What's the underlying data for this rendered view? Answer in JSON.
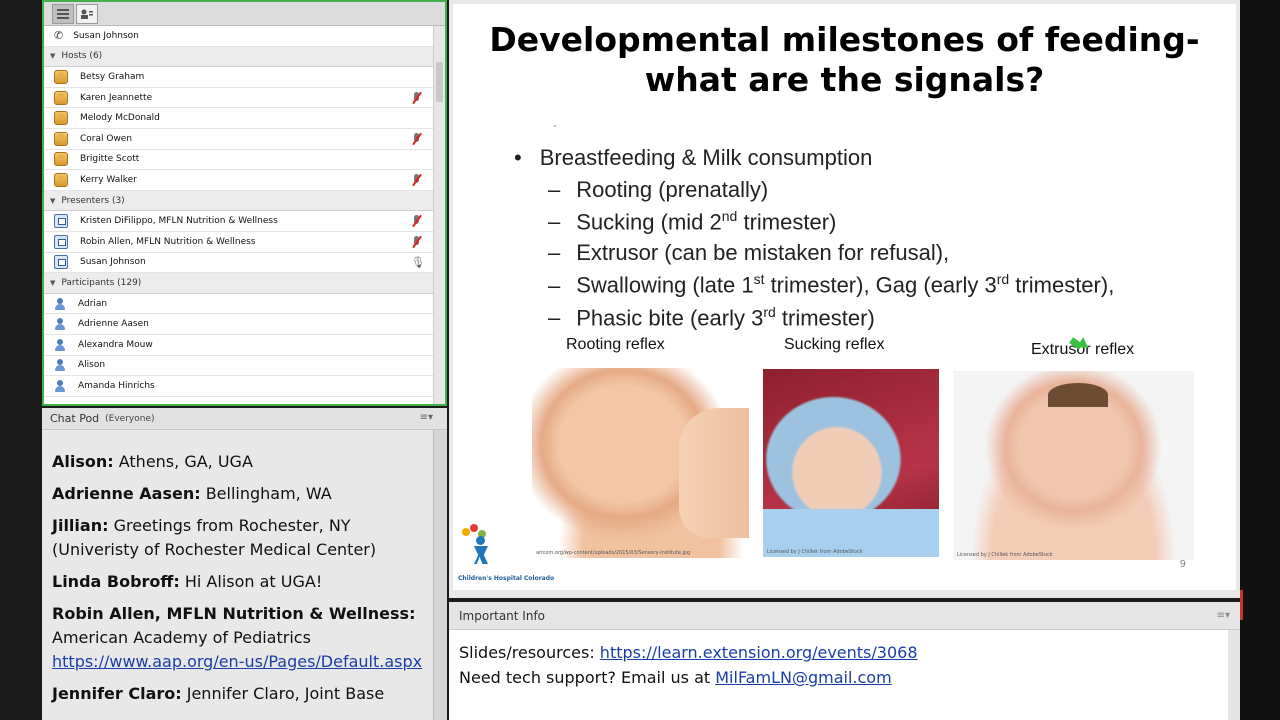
{
  "attendees": {
    "current_user": "Susan Johnson",
    "groups": [
      {
        "label": "Hosts (6)",
        "role": "host",
        "members": [
          {
            "name": "Betsy Graham",
            "status": ""
          },
          {
            "name": "Karen Jeannette",
            "status": "mic-off"
          },
          {
            "name": "Melody McDonald",
            "status": ""
          },
          {
            "name": "Coral Owen",
            "status": "mic-off"
          },
          {
            "name": "Brigitte Scott",
            "status": ""
          },
          {
            "name": "Kerry Walker",
            "status": "mic-off"
          }
        ]
      },
      {
        "label": "Presenters (3)",
        "role": "presenter",
        "members": [
          {
            "name": "Kristen DiFilippo, MFLN Nutrition & Wellness",
            "status": "mic-off"
          },
          {
            "name": "Robin Allen, MFLN Nutrition & Wellness",
            "status": "mic-off"
          },
          {
            "name": "Susan Johnson",
            "status": "speaking"
          }
        ]
      },
      {
        "label": "Participants (129)",
        "role": "participant",
        "members": [
          {
            "name": "Adrian",
            "status": ""
          },
          {
            "name": "Adrienne Aasen",
            "status": ""
          },
          {
            "name": "Alexandra Mouw",
            "status": ""
          },
          {
            "name": "Alison",
            "status": ""
          },
          {
            "name": "Amanda Hinrichs",
            "status": ""
          }
        ]
      }
    ]
  },
  "chat": {
    "title": "Chat Pod",
    "scope": "(Everyone)",
    "messages": [
      {
        "sender": "Alison:",
        "text": " Athens, GA, UGA"
      },
      {
        "sender": "Adrienne Aasen:",
        "text": " Bellingham, WA"
      },
      {
        "sender": "Jillian:",
        "text": " Greetings from Rochester, NY (Univeristy of Rochester Medical Center)"
      },
      {
        "sender": "Linda Bobroff:",
        "text": " Hi Alison at UGA!"
      },
      {
        "sender": "Robin Allen, MFLN Nutrition & Wellness:",
        "text": " American Academy of Pediatrics",
        "link": "https://www.aap.org/en-us/Pages/Default.aspx"
      },
      {
        "sender": "Jennifer Claro:",
        "text": " Jennifer Claro, Joint Base"
      }
    ]
  },
  "slide": {
    "title_line1": "Developmental milestones of feeding-",
    "title_line2": "what are the signals?",
    "dash": "-",
    "bullet": "Breastfeeding & Milk consumption",
    "sub_rooting": "Rooting (prenatally)",
    "sub_sucking_a": "Sucking (mid 2",
    "sub_sucking_sup": "nd",
    "sub_sucking_b": " trimester)",
    "sub_extrusor": "Extrusor (can be mistaken for refusal),",
    "sub_swallow_a": "Swallowing (late 1",
    "sub_swallow_sup1": "st",
    "sub_swallow_b": " trimester), Gag (early 3",
    "sub_swallow_sup2": "rd",
    "sub_swallow_c": " trimester),",
    "sub_phasic_a": "Phasic bite (early 3",
    "sub_phasic_sup": "rd",
    "sub_phasic_b": " trimester)",
    "cap_rooting": "Rooting reflex",
    "cap_sucking": "Sucking reflex",
    "cap_extrusor": "Extrusor reflex",
    "credit1": "aricom.org/wp-content/uploads/2015/03/Sensory-Institute.jpg",
    "credit2": "Licensed by J Chillek from AdobeStock",
    "credit3": "Licensed by J Chillek from AdobeStock",
    "logo_text": "Children's Hospital Colorado",
    "page_number": "9"
  },
  "info": {
    "title": "Important Info",
    "line1_label": "Slides/resources: ",
    "line1_link": "https://learn.extension.org/events/3068",
    "line2_label": "Need tech support? Email us at ",
    "line2_link": "MilFamLN@gmail.com"
  },
  "colors": {
    "pod_border": "#3fb24a",
    "link": "#1a3ea8",
    "pointer": "#35c23f"
  }
}
